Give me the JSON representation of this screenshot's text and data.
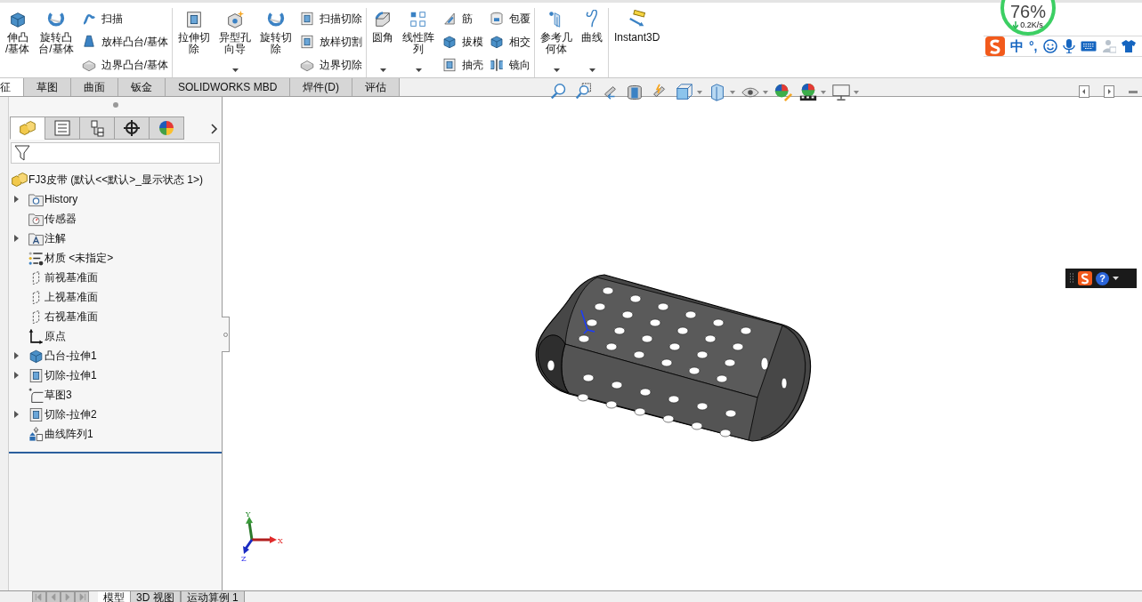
{
  "ribbon": {
    "groups": [
      {
        "large": [
          {
            "lines": [
              "伸凸",
              "/基体"
            ],
            "kind": "boss",
            "dropdown": false
          },
          {
            "lines": [
              "旋转凸",
              "台/基体"
            ],
            "kind": "revolve",
            "dropdown": false
          }
        ],
        "small_columns": [
          [
            {
              "label": "扫描",
              "kind": "sweep"
            },
            {
              "label": "放样凸台/基体",
              "kind": "loft"
            },
            {
              "label": "边界凸台/基体",
              "kind": "boundary"
            }
          ]
        ]
      },
      {
        "large": [
          {
            "lines": [
              "拉伸切",
              "除"
            ],
            "kind": "cut",
            "dropdown": false
          },
          {
            "lines": [
              "异型孔",
              "向导"
            ],
            "kind": "hole",
            "dropdown": true
          },
          {
            "lines": [
              "旋转切",
              "除"
            ],
            "kind": "revolve_cut",
            "dropdown": false
          }
        ],
        "small_columns": [
          [
            {
              "label": "扫描切除",
              "kind": "sweep_cut"
            },
            {
              "label": "放样切割",
              "kind": "loft_cut"
            },
            {
              "label": "边界切除",
              "kind": "boundary"
            }
          ]
        ]
      },
      {
        "large": [
          {
            "lines": [
              "圆角"
            ],
            "kind": "fillet",
            "dropdown": true
          },
          {
            "lines": [
              "线性阵",
              "列"
            ],
            "kind": "pattern",
            "dropdown": true
          }
        ],
        "small_columns": [
          [
            {
              "label": "筋",
              "kind": "rib"
            },
            {
              "label": "拔模",
              "kind": "draft"
            },
            {
              "label": "抽壳",
              "kind": "shell"
            }
          ],
          [
            {
              "label": "包覆",
              "kind": "wrap"
            },
            {
              "label": "相交",
              "kind": "intersect"
            },
            {
              "label": "镜向",
              "kind": "mirror"
            }
          ]
        ]
      },
      {
        "large": [
          {
            "lines": [
              "参考几",
              "何体"
            ],
            "kind": "reference",
            "dropdown": true
          },
          {
            "lines": [
              "曲线"
            ],
            "kind": "curve",
            "dropdown": true
          }
        ]
      },
      {
        "large": [
          {
            "lines": [
              "Instant3D"
            ],
            "kind": "instant3d",
            "dropdown": false
          }
        ]
      }
    ]
  },
  "command_tabs": [
    {
      "label": "征",
      "selected": true
    },
    {
      "label": "草图",
      "selected": false
    },
    {
      "label": "曲面",
      "selected": false
    },
    {
      "label": "钣金",
      "selected": false
    },
    {
      "label": "SOLIDWORKS MBD",
      "selected": false
    },
    {
      "label": "焊件(D)",
      "selected": false
    },
    {
      "label": "评估",
      "selected": false
    }
  ],
  "network_widget": {
    "percent": "76%",
    "speed": "0.2K/s"
  },
  "ime_bar": {
    "mode": "中",
    "punctuation": "°,"
  },
  "ime_mini_bar": {
    "help": "?"
  },
  "panel_tabs": [
    {
      "kind": "features",
      "selected": true
    },
    {
      "kind": "properties",
      "selected": false
    },
    {
      "kind": "configurations",
      "selected": false
    },
    {
      "kind": "dimxpert",
      "selected": false
    },
    {
      "kind": "display",
      "selected": false
    }
  ],
  "tree": {
    "label": "FJ3皮带  (默认<<默认>_显示状态 1>)",
    "kind": "part",
    "children": [
      {
        "label": "History",
        "kind": "history",
        "expandable": true
      },
      {
        "label": "传感器",
        "kind": "sensors",
        "expandable": false
      },
      {
        "label": "注解",
        "kind": "annotations",
        "expandable": true
      },
      {
        "label": "材质 <未指定>",
        "kind": "material",
        "expandable": false
      },
      {
        "label": "前视基准面",
        "kind": "plane",
        "expandable": false
      },
      {
        "label": "上视基准面",
        "kind": "plane",
        "expandable": false
      },
      {
        "label": "右视基准面",
        "kind": "plane",
        "expandable": false
      },
      {
        "label": "原点",
        "kind": "origin",
        "expandable": false
      },
      {
        "label": "凸台-拉伸1",
        "kind": "boss",
        "expandable": true
      },
      {
        "label": "切除-拉伸1",
        "kind": "cut",
        "expandable": true
      },
      {
        "label": "草图3",
        "kind": "sketch",
        "expandable": false
      },
      {
        "label": "切除-拉伸2",
        "kind": "cut",
        "expandable": true
      },
      {
        "label": "曲线阵列1",
        "kind": "pattern",
        "expandable": false
      }
    ]
  },
  "triad": {
    "x": "X",
    "y": "Y",
    "z": "Z"
  },
  "bottom_tabs": [
    {
      "label": "模型",
      "selected": true
    },
    {
      "label": "3D 视图",
      "selected": false
    },
    {
      "label": "运动算例 1",
      "selected": false
    }
  ]
}
